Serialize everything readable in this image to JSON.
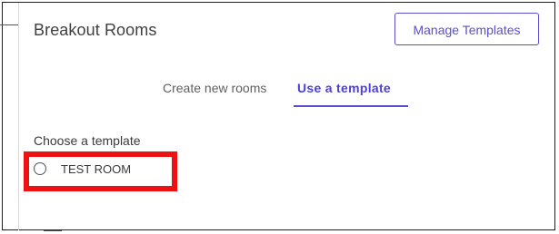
{
  "header": {
    "title": "Breakout Rooms",
    "manage_templates_label": "Manage Templates"
  },
  "tabs": [
    {
      "label": "Create new rooms",
      "active": false
    },
    {
      "label": "Use a template",
      "active": true
    }
  ],
  "template_section": {
    "heading": "Choose a template",
    "options": [
      {
        "label": "TEST ROOM",
        "selected": false
      }
    ]
  },
  "colors": {
    "accent": "#5a4fcf",
    "active_tab_text": "#4b3fd6",
    "highlight": "#ee1111"
  }
}
